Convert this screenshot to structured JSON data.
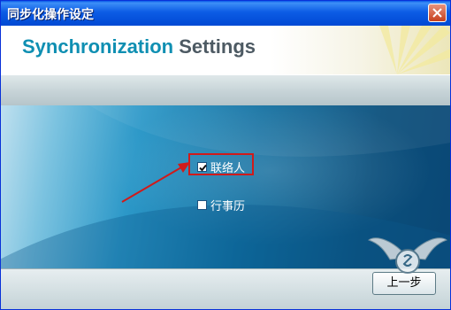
{
  "window": {
    "title": "同步化操作设定"
  },
  "header": {
    "title_part1": "Synchronization",
    "title_part2": "Settings"
  },
  "options": [
    {
      "label": "联络人",
      "checked": true
    },
    {
      "label": "行事历",
      "checked": false
    }
  ],
  "footer": {
    "prev_label": "上一步"
  },
  "colors": {
    "accent": "#0f8fb2",
    "highlight": "#d11a1a",
    "titlebar": "#0049d3"
  }
}
